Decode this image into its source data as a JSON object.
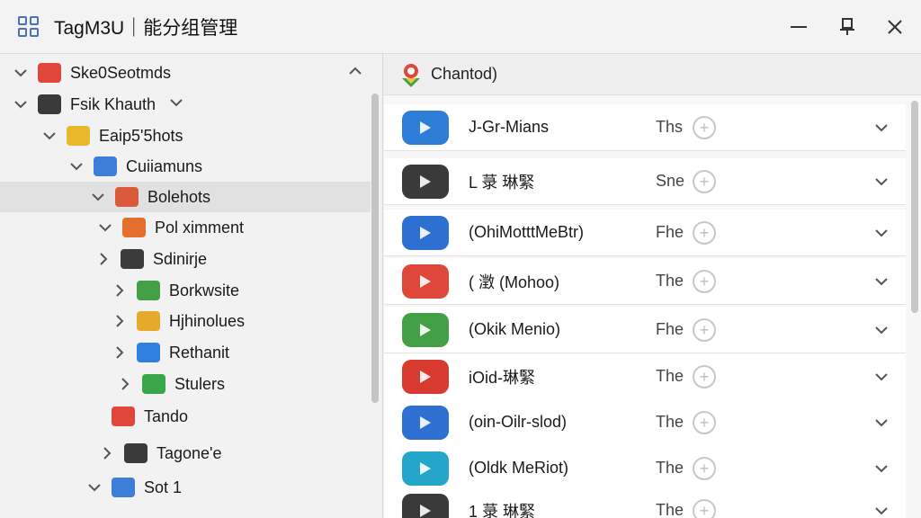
{
  "window": {
    "title": "TagM3U｜能分组管理"
  },
  "tree": [
    {
      "label": "Ske0Seotmds",
      "toggle": "down",
      "icon": "video-folder-icon",
      "color": "#e0473b"
    },
    {
      "label": "Fsik Khauth",
      "toggle": "down",
      "icon": "person-folder-icon",
      "color": "#3a3a3a"
    },
    {
      "label": "Eaip5'5hots",
      "toggle": "down",
      "icon": "layers-icon",
      "color": "#e8b92b"
    },
    {
      "label": "Cuiiamuns",
      "toggle": "down",
      "icon": "mail-icon",
      "color": "#3f7ed8"
    },
    {
      "label": "Bolehots",
      "toggle": "down",
      "icon": "bookmark-icon",
      "color": "#d95b3b",
      "selected": true
    },
    {
      "label": "Pol ximment",
      "toggle": "down",
      "icon": "stack-icon",
      "color": "#e46f2d"
    },
    {
      "label": "Sdinirje",
      "toggle": "right",
      "icon": "network-folder-icon",
      "color": "#3b3b3b"
    },
    {
      "label": "Borkwsite",
      "toggle": "right",
      "icon": "layers-icon",
      "color": "#43a047"
    },
    {
      "label": "Hjhinolues",
      "toggle": "right",
      "icon": "folder-icon",
      "color": "#e5a92b"
    },
    {
      "label": "Rethanit",
      "toggle": "right",
      "icon": "home-icon",
      "color": "#2f7fe0"
    },
    {
      "label": "Stulers",
      "toggle": "right",
      "icon": "person-icon",
      "color": "#3aa64a"
    },
    {
      "label": "Tando",
      "toggle": "none",
      "icon": "pie-chart-icon",
      "color": "#e0473b"
    },
    {
      "label": "Tagone'e",
      "toggle": "right",
      "icon": "person-folder-icon",
      "color": "#3a3a3a"
    },
    {
      "label": "Sot 1",
      "toggle": "down",
      "icon": "stack-icon",
      "color": "#3f7ed8"
    }
  ],
  "header": {
    "label": "Chantod)"
  },
  "channels": [
    {
      "name": "J-Gr-Mians",
      "value": "Ths",
      "color": "#2e7dd7"
    },
    {
      "name": "L 菉 琳緊",
      "value": "Sne",
      "color": "#3a3a3a"
    },
    {
      "name": "(OhiMotttMeBtr)",
      "value": "Fhe",
      "color": "#2e6fd2"
    },
    {
      "name": "( 澂 (Mohoo)",
      "value": "The",
      "color": "#e0473b"
    },
    {
      "name": "(Okik Menio)",
      "value": "Fhe",
      "color": "#43a047"
    },
    {
      "name": "iOid-琳緊",
      "value": "The",
      "color": "#d83a2f"
    },
    {
      "name": "(oin-Oilr-slod)",
      "value": "The",
      "color": "#2e6fd2"
    },
    {
      "name": "(Oldk MeRiot)",
      "value": "The",
      "color": "#23a6c9"
    },
    {
      "name": "1 菉 琳緊",
      "value": "The",
      "color": "#3a3a3a"
    }
  ]
}
